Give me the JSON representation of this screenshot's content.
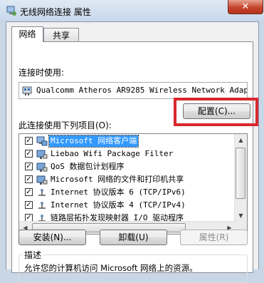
{
  "window": {
    "title": "无线网络连接 属性",
    "close_label": "✕"
  },
  "tabs": [
    {
      "label": "网络",
      "active": true
    },
    {
      "label": "共享",
      "active": false
    }
  ],
  "connect_using": {
    "label": "连接时使用:",
    "adapter": "Qualcomm Atheros AR9285 Wireless Network Adapt",
    "configure_button": "配置(C)..."
  },
  "items_section": {
    "label": "此连接使用下列项目(O):",
    "items": [
      {
        "name": "Microsoft 网络客户端",
        "checked": true,
        "icon": "network-client-icon",
        "selected": true
      },
      {
        "name": "Liebao Wifi Package Filter",
        "checked": true,
        "icon": "network-service-icon",
        "selected": false
      },
      {
        "name": "QoS 数据包计划程序",
        "checked": true,
        "icon": "network-service-icon",
        "selected": false
      },
      {
        "name": "Microsoft 网络的文件和打印机共享",
        "checked": true,
        "icon": "network-service-icon",
        "selected": false
      },
      {
        "name": "Internet 协议版本 6 (TCP/IPv6)",
        "checked": true,
        "icon": "protocol-icon",
        "selected": false
      },
      {
        "name": "Internet 协议版本 4 (TCP/IPv4)",
        "checked": true,
        "icon": "protocol-icon",
        "selected": false
      },
      {
        "name": "链路层拓扑发现映射器 I/O 驱动程序",
        "checked": true,
        "icon": "protocol-icon",
        "selected": false
      }
    ]
  },
  "buttons": {
    "install": "安装(N)...",
    "uninstall": "卸载(U)",
    "properties": "属性(R)"
  },
  "description": {
    "legend": "描述",
    "text": "允许您的计算机访问 Microsoft 网络上的资源。"
  },
  "colors": {
    "highlight_frame": "#d7282d",
    "selection": "#3399ff"
  }
}
